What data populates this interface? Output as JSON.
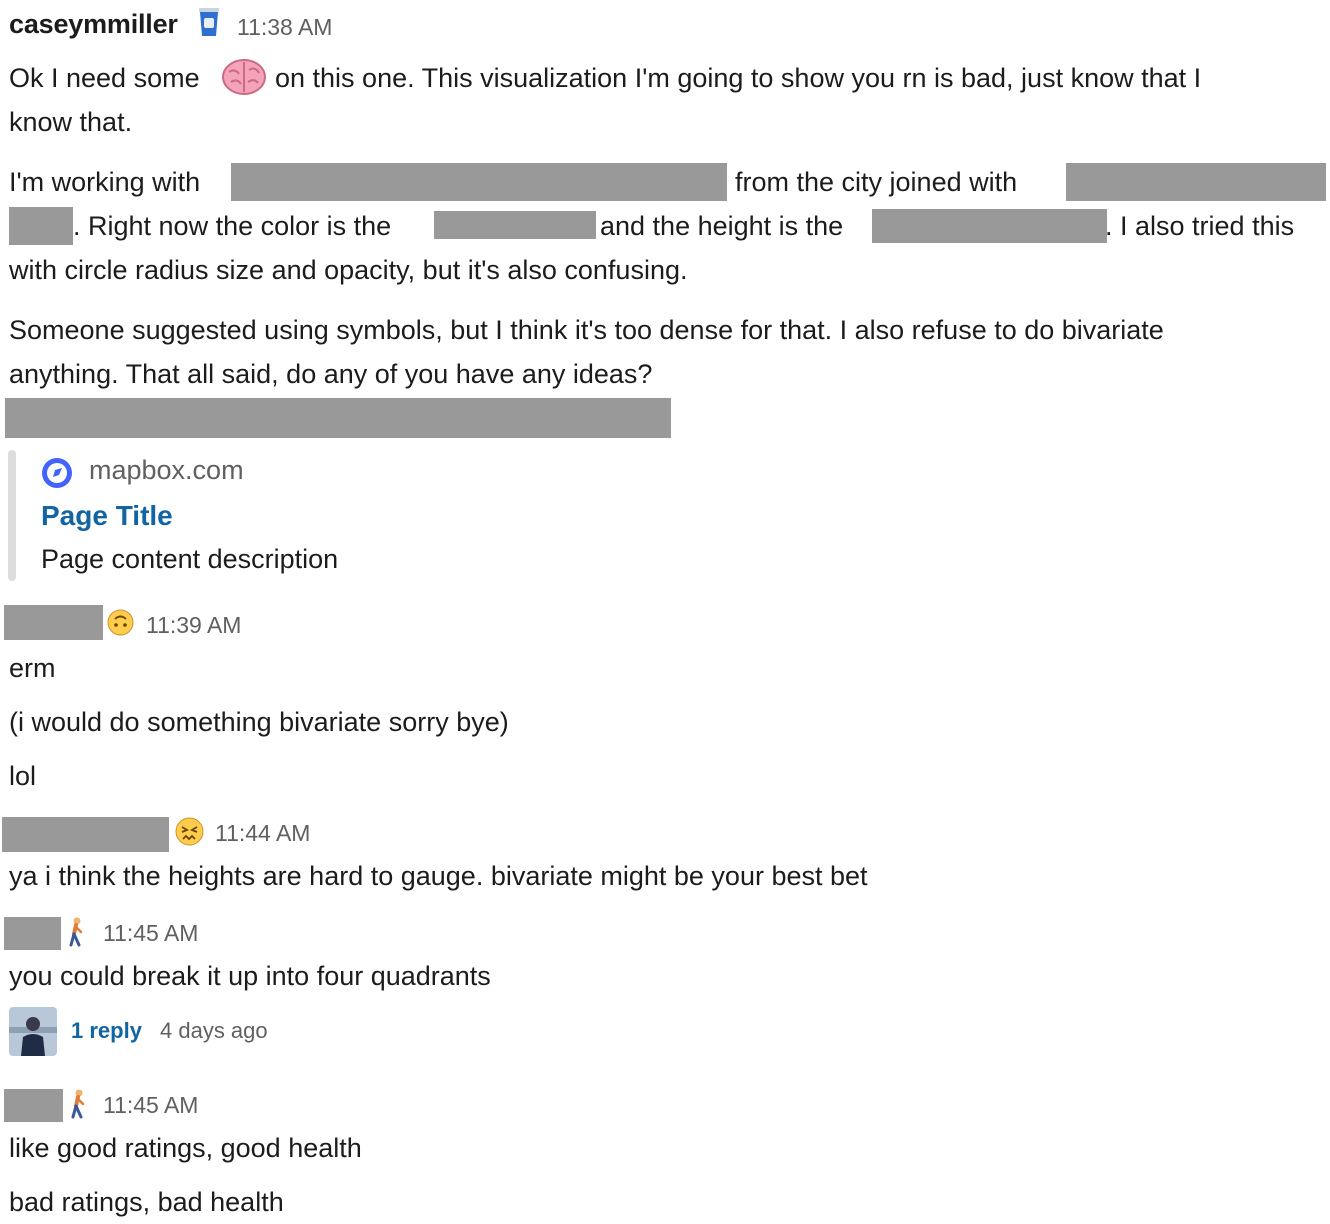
{
  "messages": [
    {
      "username": "caseymmiller",
      "time": "11:38 AM",
      "p1_a": "Ok I need some",
      "p1_b": "on this one. This visualization I'm going to show you rn is bad, just know that I",
      "p1_c": "know that.",
      "p2_a": "I'm working with",
      "p2_b": "from the city joined with",
      "p2_c": ". Right now the color is the",
      "p2_d": "and the height is the",
      "p2_e": ". I also tried this",
      "p2_f": "with circle radius size and opacity, but it's also confusing.",
      "p3_a": "Someone suggested using symbols, but I think it's too dense for that. I also refuse to do bivariate",
      "p3_b": "anything. That all said, do any of you have any ideas?",
      "unfurl": {
        "domain": "mapbox.com",
        "title": "Page Title",
        "description": "Page content description"
      }
    },
    {
      "time": "11:39 AM",
      "lines": [
        "erm",
        "(i would do something bivariate sorry bye)",
        "lol"
      ]
    },
    {
      "time": "11:44 AM",
      "lines": [
        "ya i think the heights are hard to gauge. bivariate might be your best bet"
      ]
    },
    {
      "time": "11:45 AM",
      "lines": [
        "you could break it up into four quadrants"
      ],
      "thread": {
        "reply_label": "1 reply",
        "ago": "4 days ago"
      }
    },
    {
      "time": "11:45 AM",
      "lines": [
        "like good ratings, good health",
        "bad ratings, bad health"
      ]
    }
  ],
  "icons": {
    "status1": "coffee-cup-icon",
    "inline_emoji": "brain-icon",
    "status2": "upside-down-face-icon",
    "status3": "confounded-face-icon",
    "status4": "person-walking-icon",
    "status5": "person-walking-icon",
    "unfurl_favicon": "compass-icon"
  },
  "colors": {
    "link": "#1264a3",
    "redaction": "#999999",
    "timestamp": "#616061",
    "mapbox_blue": "#4264fb"
  }
}
